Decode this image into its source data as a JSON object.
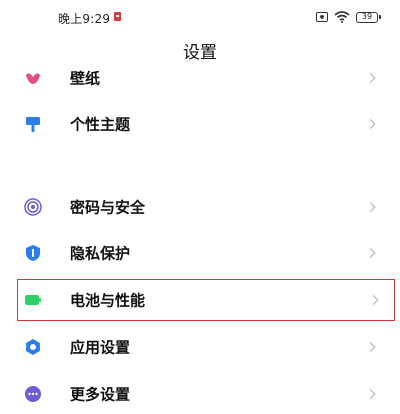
{
  "status_bar": {
    "time": "晚上9:29",
    "battery": "39"
  },
  "header": {
    "title": "设置"
  },
  "settings": {
    "items": [
      {
        "label": "壁纸",
        "icon": "wallpaper-icon",
        "color": "#e0507a"
      },
      {
        "label": "个性主题",
        "icon": "theme-brush-icon",
        "color": "#2b7de9"
      },
      {
        "label": "密码与安全",
        "icon": "fingerprint-icon",
        "color": "#6a5cd6"
      },
      {
        "label": "隐私保护",
        "icon": "privacy-shield-icon",
        "color": "#2b7de9"
      },
      {
        "label": "电池与性能",
        "icon": "battery-icon",
        "color": "#2fcf6b",
        "highlighted": true
      },
      {
        "label": "应用设置",
        "icon": "app-gear-icon",
        "color": "#2b7de9"
      },
      {
        "label": "更多设置",
        "icon": "more-dots-icon",
        "color": "#6a5cd6"
      }
    ]
  },
  "colors": {
    "highlight_border": "#c93a3a",
    "chevron": "#b0b0b0"
  }
}
